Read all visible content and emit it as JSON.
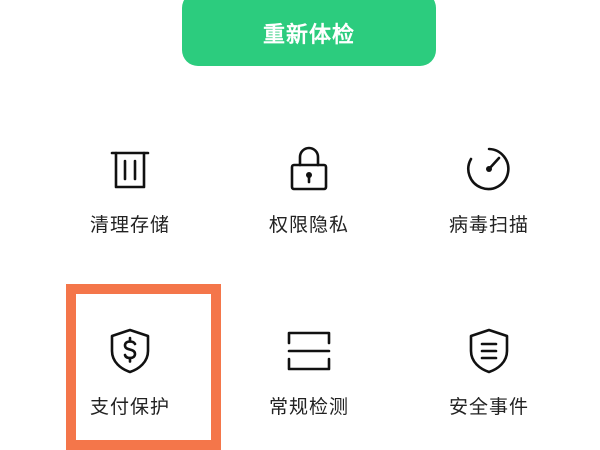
{
  "recheck": {
    "label": "重新体检"
  },
  "tools": [
    {
      "label": "清理存储",
      "icon": "trash-icon"
    },
    {
      "label": "权限隐私",
      "icon": "lock-icon"
    },
    {
      "label": "病毒扫描",
      "icon": "gauge-icon"
    },
    {
      "label": "支付保护",
      "icon": "shield-dollar-icon"
    },
    {
      "label": "常规检测",
      "icon": "scan-frame-icon"
    },
    {
      "label": "安全事件",
      "icon": "shield-list-icon"
    }
  ],
  "colors": {
    "accent_green": "#2ccc7e",
    "highlight_orange": "#f4764a",
    "text": "#222222",
    "icon": "#111111"
  }
}
